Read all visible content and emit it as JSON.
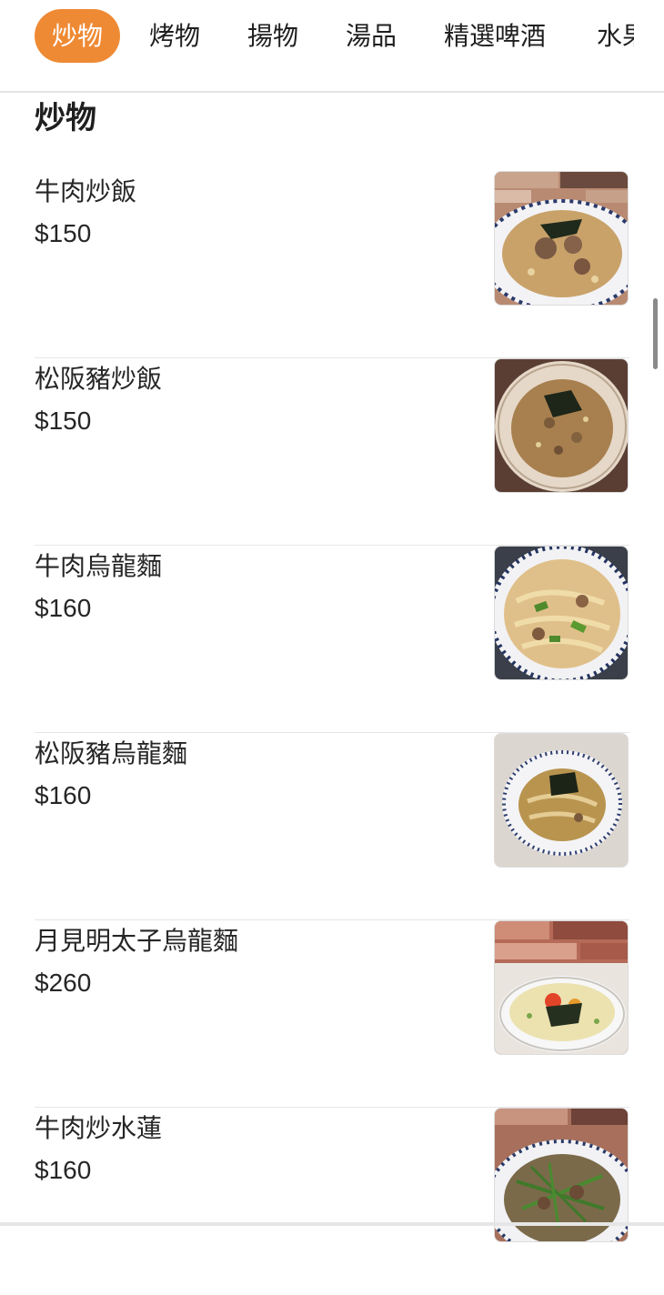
{
  "tabs": [
    {
      "label": "炒物",
      "active": true
    },
    {
      "label": "烤物",
      "active": false
    },
    {
      "label": "揚物",
      "active": false
    },
    {
      "label": "湯品",
      "active": false
    },
    {
      "label": "精選啤酒",
      "active": false
    },
    {
      "label": "水果",
      "active": false
    }
  ],
  "section": {
    "title": "炒物"
  },
  "items": [
    {
      "name": "牛肉炒飯",
      "price": "$150"
    },
    {
      "name": "松阪豬炒飯",
      "price": "$150"
    },
    {
      "name": "牛肉烏龍麵",
      "price": "$160"
    },
    {
      "name": "松阪豬烏龍麵",
      "price": "$160"
    },
    {
      "name": "月見明太子烏龍麵",
      "price": "$260"
    },
    {
      "name": "牛肉炒水蓮",
      "price": "$160"
    }
  ],
  "colors": {
    "accent": "#ef8a34"
  }
}
